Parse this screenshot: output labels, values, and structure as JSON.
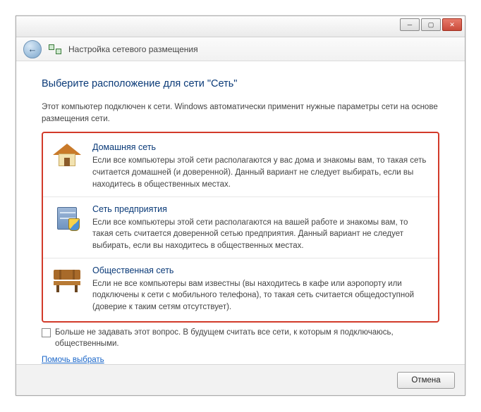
{
  "title_bar": {},
  "nav": {
    "title": "Настройка сетевого размещения"
  },
  "heading": "Выберите расположение для сети \"Сеть\"",
  "intro": "Этот компьютер подключен к сети. Windows автоматически применит нужные параметры сети на основе размещения сети.",
  "options": [
    {
      "title": "Домашняя сеть",
      "desc": "Если все компьютеры этой сети располагаются у вас дома и знакомы вам, то такая сеть считается домашней (и доверенной). Данный вариант не следует выбирать, если вы находитесь в общественных местах."
    },
    {
      "title": "Сеть предприятия",
      "desc": "Если все компьютеры этой сети располагаются на вашей работе и знакомы вам, то такая сеть считается доверенной сетью предприятия. Данный вариант не следует выбирать, если вы находитесь в общественных местах."
    },
    {
      "title": "Общественная сеть",
      "desc": "Если не все компьютеры вам известны (вы находитесь в кафе или аэропорту или подключены к сети с мобильного телефона), то такая сеть считается общедоступной (доверие к таким сетям отсутствует)."
    }
  ],
  "checkbox_label": "Больше не задавать этот вопрос. В будущем считать все сети, к которым я подключаюсь, общественными.",
  "help_link": "Помочь выбрать",
  "buttons": {
    "cancel": "Отмена"
  }
}
